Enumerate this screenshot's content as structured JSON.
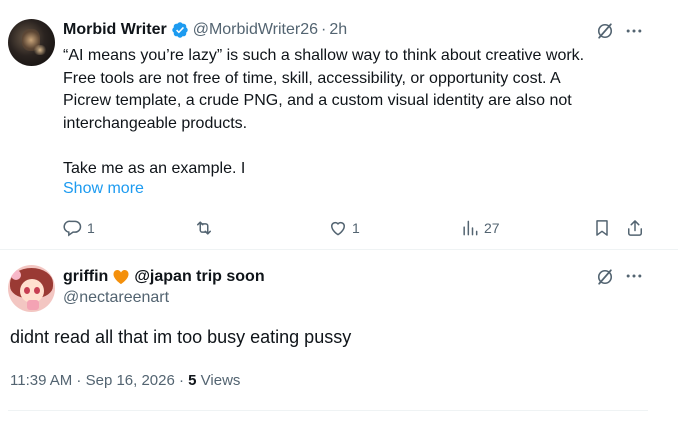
{
  "tweet1": {
    "author_name": "Morbid Writer",
    "handle": "@MorbidWriter26",
    "separator": "·",
    "time": "2h",
    "text_lines": [
      "“AI means you’re lazy” is such a shallow way to think about creative work.",
      "Free tools are not free of time, skill, accessibility, or opportunity cost. A",
      "Picrew template, a crude PNG, and a custom visual identity are also not",
      "interchangeable products.",
      "",
      "Take me as an example. I"
    ],
    "show_more": "Show more",
    "stats": {
      "replies": "1",
      "likes": "1",
      "views": "27"
    }
  },
  "tweet2": {
    "author_name": "griffin",
    "name_suffix": "@japan trip soon",
    "handle": "@nectareenart",
    "text": "didnt read all that im too busy eating pussy",
    "timestamp": "11:39 AM · Sep 16, 2026 · ",
    "views_count": "5",
    "views_label": " Views"
  },
  "colors": {
    "text": "#0f1419",
    "secondary": "#536471",
    "link": "#1d9bf0",
    "verified": "#1d9bf0",
    "divider": "#eff3f4",
    "heart": "#f4900c"
  },
  "icons": [
    "verified-badge-icon",
    "grok-icon",
    "more-icon",
    "reply-icon",
    "repost-icon",
    "like-icon",
    "views-icon",
    "bookmark-icon",
    "share-icon",
    "orange-heart-icon"
  ]
}
